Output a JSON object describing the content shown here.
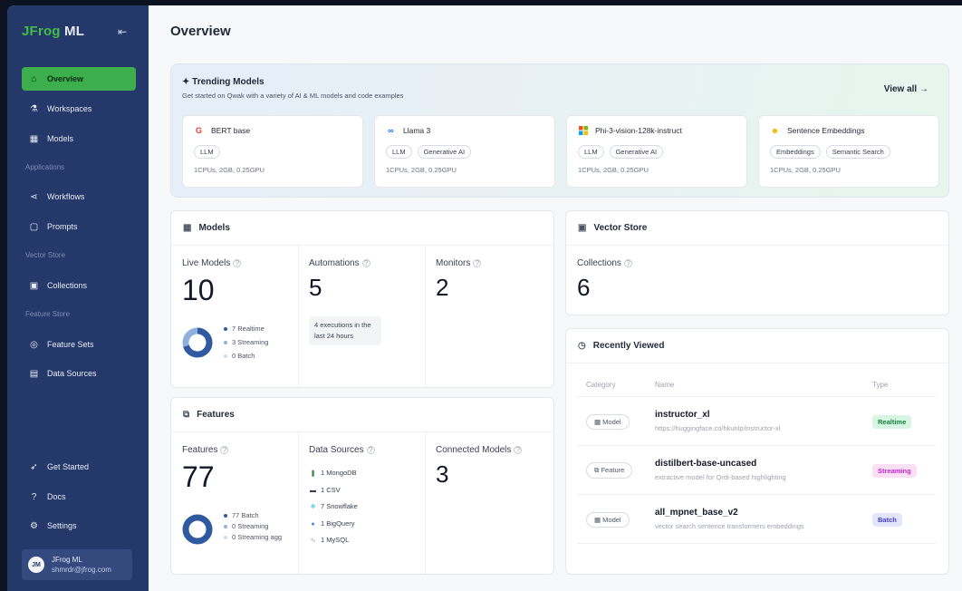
{
  "sidebar": {
    "brand_prefix": "JFrog",
    "brand_suffix": " ML",
    "items": [
      {
        "label": "Overview",
        "icon": "home-icon"
      },
      {
        "label": "Workspaces",
        "icon": "flask-icon"
      },
      {
        "label": "Models",
        "icon": "grid-icon"
      },
      {
        "label": "Workflows",
        "icon": "share-icon"
      },
      {
        "label": "Prompts",
        "icon": "chat-icon"
      },
      {
        "label": "Collections",
        "icon": "layers-icon"
      },
      {
        "label": "Feature Sets",
        "icon": "gauge-icon"
      },
      {
        "label": "Data Sources",
        "icon": "table-icon"
      }
    ],
    "sections": {
      "applications": "Applications",
      "vector_store": "Vector Store",
      "feature_store": "Feature Store"
    },
    "bottom_items": [
      {
        "label": "Get Started",
        "icon": "rocket-icon"
      },
      {
        "label": "Docs",
        "icon": "help-icon"
      },
      {
        "label": "Settings",
        "icon": "gear-icon"
      }
    ],
    "user": {
      "initials": "JM",
      "name": "JFrog ML",
      "email": "shmrdr@jfrog.com"
    }
  },
  "header": {
    "title": "Overview"
  },
  "trending": {
    "title": "✦ Trending Models",
    "subtitle": "Get started on Qwak with a variety of AI & ML models and code examples",
    "view_all": "View all →",
    "cards": [
      {
        "name": "BERT base",
        "tags": [
          "LLM"
        ],
        "resources": "1CPUs, 2GB, 0.25GPU",
        "icon": "google-icon",
        "icon_char": "G",
        "icon_color": "#ea4335"
      },
      {
        "name": "Llama 3",
        "tags": [
          "LLM",
          "Generative AI"
        ],
        "resources": "1CPUs, 2GB, 0.25GPU",
        "icon": "meta-icon",
        "icon_char": "∞",
        "icon_color": "#1877f2"
      },
      {
        "name": "Phi-3-vision-128k-instruct",
        "tags": [
          "LLM",
          "Generative AI"
        ],
        "resources": "1CPUs, 2GB, 0.25GPU",
        "icon": "microsoft-icon",
        "icon_char": "■",
        "icon_color": "#f25022"
      },
      {
        "name": "Sentence Embeddings",
        "tags": [
          "Embeddings",
          "Semantic Search"
        ],
        "resources": "1CPUs, 2GB, 0.25GPU",
        "icon": "huggingface-icon",
        "icon_char": "☻",
        "icon_color": "#f5b800"
      }
    ]
  },
  "models": {
    "title": "Models",
    "live": {
      "label": "Live Models",
      "value": "10",
      "legend": [
        "7 Realtime",
        "3 Streaming",
        "0 Batch"
      ],
      "breakdown": [
        7,
        3,
        0
      ]
    },
    "automations": {
      "label": "Automations",
      "value": "5",
      "note": "4 executions in the last 24 hours"
    },
    "monitors": {
      "label": "Monitors",
      "value": "2"
    }
  },
  "features": {
    "title": "Features",
    "count": {
      "label": "Features",
      "value": "77",
      "legend": [
        "77 Batch",
        "0 Streaming",
        "0 Streaming agg"
      ],
      "breakdown": [
        77,
        0,
        0
      ]
    },
    "data_sources": {
      "label": "Data Sources",
      "items": [
        "1 MongoDB",
        "1 CSV",
        "7 Snowflake",
        "1 BigQuery",
        "1 MySQL"
      ]
    },
    "connected": {
      "label": "Connected Models",
      "value": "3"
    }
  },
  "vector_store": {
    "title": "Vector Store",
    "collections_label": "Collections",
    "collections_value": "6"
  },
  "recent": {
    "title": "Recently Viewed",
    "columns": [
      "Category",
      "Name",
      "Type"
    ],
    "rows": [
      {
        "category": "Model",
        "name": "instructor_xl",
        "desc": "https://huggingface.co/hkunlp/instructor-xl",
        "type": "Realtime",
        "type_bg": "#d6f5e3",
        "type_fg": "#15803d"
      },
      {
        "category": "Feature",
        "name": "distilbert-base-uncased",
        "desc": "extractive model for Qrdi-based highlighting",
        "type": "Streaming",
        "type_bg": "#fbe0f5",
        "type_fg": "#c026d3"
      },
      {
        "category": "Model",
        "name": "all_mpnet_base_v2",
        "desc": "vector search sentence transformers embeddings",
        "type": "Batch",
        "type_bg": "#e3e6fb",
        "type_fg": "#4338ca"
      }
    ]
  },
  "colors": {
    "sidebar": "#25386a",
    "accent": "#3cae4b",
    "donut_primary": "#2f5aa0",
    "donut_secondary": "#8fb0de",
    "donut_tertiary": "#cdd9ee"
  }
}
